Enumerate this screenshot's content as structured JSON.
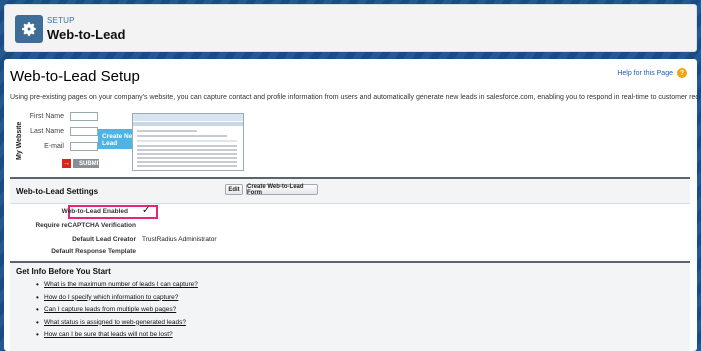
{
  "header": {
    "eyebrow": "SETUP",
    "title": "Web-to-Lead",
    "icon": "gear-icon"
  },
  "main": {
    "title": "Web-to-Lead Setup",
    "help_link": "Help for this Page",
    "help_icon": "?",
    "intro": "Using pre-existing pages on your company's website, you can capture contact and profile information from users and automatically generate new leads in salesforce.com, enabling you to respond in real-time to customer requests."
  },
  "illustration": {
    "vertical_label": "My Website",
    "fields": [
      "First Name",
      "Last Name",
      "E-mail"
    ],
    "submit_arrow": "→",
    "submit_label": "SUBMIT",
    "arrow_label": "Create New Lead"
  },
  "settings": {
    "title": "Web-to-Lead Settings",
    "edit_label": "Edit",
    "create_form_label": "Create Web-to-Lead Form",
    "rows": [
      {
        "label": "Web-to-Lead Enabled",
        "value": "✓"
      },
      {
        "label": "Require reCAPTCHA Verification",
        "value": ""
      },
      {
        "label": "Default Lead Creator",
        "value": "TrustRadius Administrator"
      },
      {
        "label": "Default Response Template",
        "value": ""
      }
    ]
  },
  "getinfo": {
    "title": "Get Info Before You Start",
    "links": [
      "What is the maximum number of leads I can capture?",
      "How do I specify which information to capture?",
      "Can I capture leads from multiple web pages?",
      "What status is assigned to web-generated leads?",
      "How can I be sure that leads will not be lost?"
    ]
  },
  "colors": {
    "background": "#1a4f8a",
    "highlight": "#e8247a",
    "link": "#1a5fb4",
    "help_icon": "#f2a30f"
  }
}
